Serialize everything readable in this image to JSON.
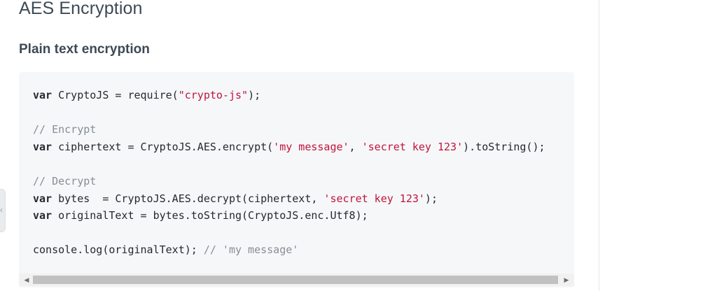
{
  "header": {
    "title": "AES Encryption",
    "subtitle": "Plain text encryption"
  },
  "code": {
    "line1": {
      "kw": "var",
      "a": " CryptoJS = require(",
      "s1": "\"crypto-js\"",
      "b": ");"
    },
    "line3": {
      "comment": "// Encrypt"
    },
    "line4": {
      "kw": "var",
      "a": " ciphertext = CryptoJS.AES.encrypt(",
      "s1": "'my message'",
      "b": ", ",
      "s2": "'secret key 123'",
      "c": ").toString();"
    },
    "line6": {
      "comment": "// Decrypt"
    },
    "line7": {
      "kw": "var",
      "a": " bytes  = CryptoJS.AES.decrypt(ciphertext, ",
      "s1": "'secret key 123'",
      "b": ");"
    },
    "line8": {
      "kw": "var",
      "a": " originalText = bytes.toString(CryptoJS.enc.Utf8);"
    },
    "line10": {
      "a": "console.log(originalText); ",
      "comment": "// 'my message'"
    }
  },
  "scrollbar": {
    "left_arrow": "◀",
    "right_arrow": "▶",
    "position": 0.0
  },
  "sidebar_toggle": {
    "icon": "chevron-left-icon",
    "glyph": "‹"
  },
  "colors": {
    "heading": "#3d4955",
    "string": "#c0143c",
    "comment": "#868e96",
    "code_bg": "#f6f7f9"
  }
}
